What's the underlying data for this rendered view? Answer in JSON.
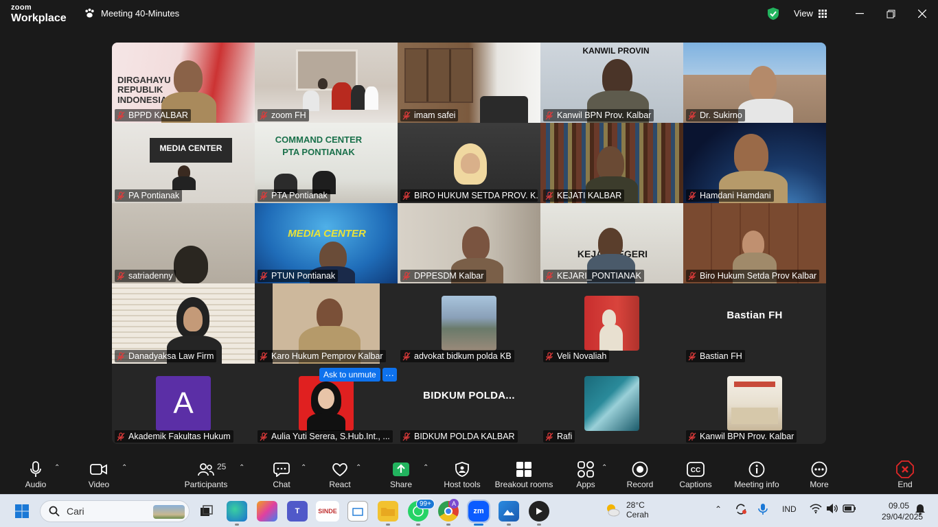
{
  "app": {
    "brand_top": "zoom",
    "brand_bottom": "Workplace",
    "meeting_title": "Meeting 40-Minutes",
    "view_label": "View"
  },
  "tiles": [
    {
      "name": "BPPD KALBAR",
      "overlay": "DIRGAHAYU REPUBLIK INDONESIA"
    },
    {
      "name": "zoom FH",
      "active": true
    },
    {
      "name": "imam safei"
    },
    {
      "name": "Kanwil BPN Prov. Kalbar",
      "overlay": "KANWIL PROVIN"
    },
    {
      "name": "Dr. Sukirno"
    },
    {
      "name": "PA Pontianak",
      "overlay": "MEDIA CENTER"
    },
    {
      "name": "PTA Pontianak",
      "overlay": "COMMAND CENTER PTA PONTIANAK"
    },
    {
      "name": "BIRO HUKUM SETDA PROV. K..."
    },
    {
      "name": "KEJATI KALBAR"
    },
    {
      "name": "Hamdani Hamdani"
    },
    {
      "name": "satriadenny"
    },
    {
      "name": "PTUN Pontianak",
      "overlay": "MEDIA CENTER"
    },
    {
      "name": "DPPESDM Kalbar"
    },
    {
      "name": "KEJARI_PONTIANAK",
      "overlay": "KEJA I NEGERI"
    },
    {
      "name": "Biro Hukum Setda Prov Kalbar"
    },
    {
      "name": "Danadyaksa Law Firm"
    },
    {
      "name": "Karo Hukum Pemprov Kalbar"
    },
    {
      "name": "advokat bidkum polda KB"
    },
    {
      "name": "Veli Novaliah"
    },
    {
      "name": "Bastian FH",
      "big": "Bastian FH"
    },
    {
      "name": "Akademik Fakultas Hukum",
      "letter": "A"
    },
    {
      "name": "Aulia Yuti Serera, S.Hub.Int., ..."
    },
    {
      "name": "BIDKUM POLDA KALBAR",
      "big": "BIDKUM POLDA..."
    },
    {
      "name": "Rafi"
    },
    {
      "name": "Kanwil BPN Prov. Kalbar"
    }
  ],
  "popup": {
    "ask_unmute": "Ask to unmute",
    "more": "···"
  },
  "toolbar": {
    "audio": "Audio",
    "video": "Video",
    "participants": "Participants",
    "participants_count": "25",
    "chat": "Chat",
    "react": "React",
    "share": "Share",
    "host_tools": "Host tools",
    "breakout": "Breakout rooms",
    "apps": "Apps",
    "record": "Record",
    "captions": "Captions",
    "meeting_info": "Meeting info",
    "more": "More",
    "end": "End"
  },
  "taskbar": {
    "search_placeholder": "Cari",
    "whatsapp_badge": "99+",
    "sinde": "SINDE",
    "weather_temp": "28°C",
    "weather_desc": "Cerah",
    "lang": "IND",
    "time": "09.05",
    "date": "29/04/2025"
  },
  "colors": {
    "accent": "#0e72ed",
    "active_border": "#25d366",
    "end_red": "#e02828"
  }
}
